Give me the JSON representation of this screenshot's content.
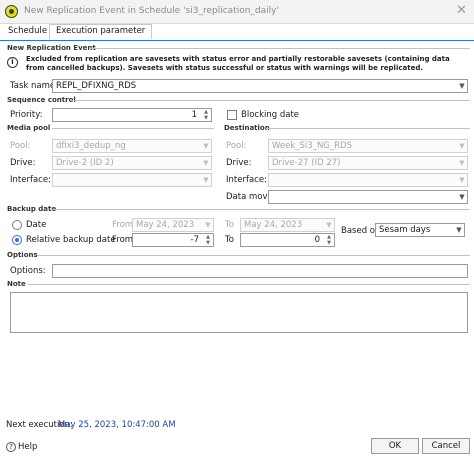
{
  "window": {
    "title": "New Replication Event in Schedule 'si3_replication_daily'",
    "close_glyph": "✕"
  },
  "tabs": [
    {
      "label": "Schedule"
    },
    {
      "label": "Execution parameter"
    }
  ],
  "event": {
    "section": "New Replication Event",
    "info": "Excluded from replication are savesets with status error and partially restorable savesets (containing data from cancelled backups). Savesets with status successful or status with warnings will be replicated.",
    "task_name_label": "Task name:",
    "task_name_value": "REPL_DFIXNG_RDS"
  },
  "sequence": {
    "section": "Sequence control",
    "priority_label": "Priority:",
    "priority_value": "1",
    "blocking_label": "Blocking date"
  },
  "media_pool": {
    "section": "Media pool",
    "pool_label": "Pool:",
    "pool_value": "dfixi3_dedup_ng",
    "drive_label": "Drive:",
    "drive_value": "Drive-2 (ID 2)",
    "interface_label": "Interface:",
    "interface_value": ""
  },
  "destination": {
    "section": "Destination",
    "pool_label": "Pool:",
    "pool_value": "Week_Si3_NG_RDS",
    "drive_label": "Drive:",
    "drive_value": "Drive-27 (ID 27)",
    "interface_label": "Interface:",
    "interface_value": "",
    "mover_label": "Data mover:",
    "mover_value": ""
  },
  "backup_date": {
    "section": "Backup date",
    "date_label": "Date",
    "relative_label": "Relative backup date",
    "from_label": "From",
    "to_label": "To",
    "date_from": "May 24, 2023",
    "date_to": "May 24, 2023",
    "rel_from": "-7",
    "rel_to": "0",
    "based_on_label": "Based on",
    "based_on_value": "Sesam days"
  },
  "options": {
    "section": "Options",
    "label": "Options:",
    "value": ""
  },
  "note": {
    "section": "Note",
    "value": ""
  },
  "footer": {
    "next_label": "Next execution:",
    "next_value": "May 25, 2023, 10:47:00 AM",
    "help_label": "Help",
    "ok_label": "OK",
    "cancel_label": "Cancel"
  },
  "icons": {
    "info": "info-icon",
    "help": "help-icon",
    "dropdown": "chevron-down-icon",
    "spinner": "spinner-arrows-icon"
  }
}
